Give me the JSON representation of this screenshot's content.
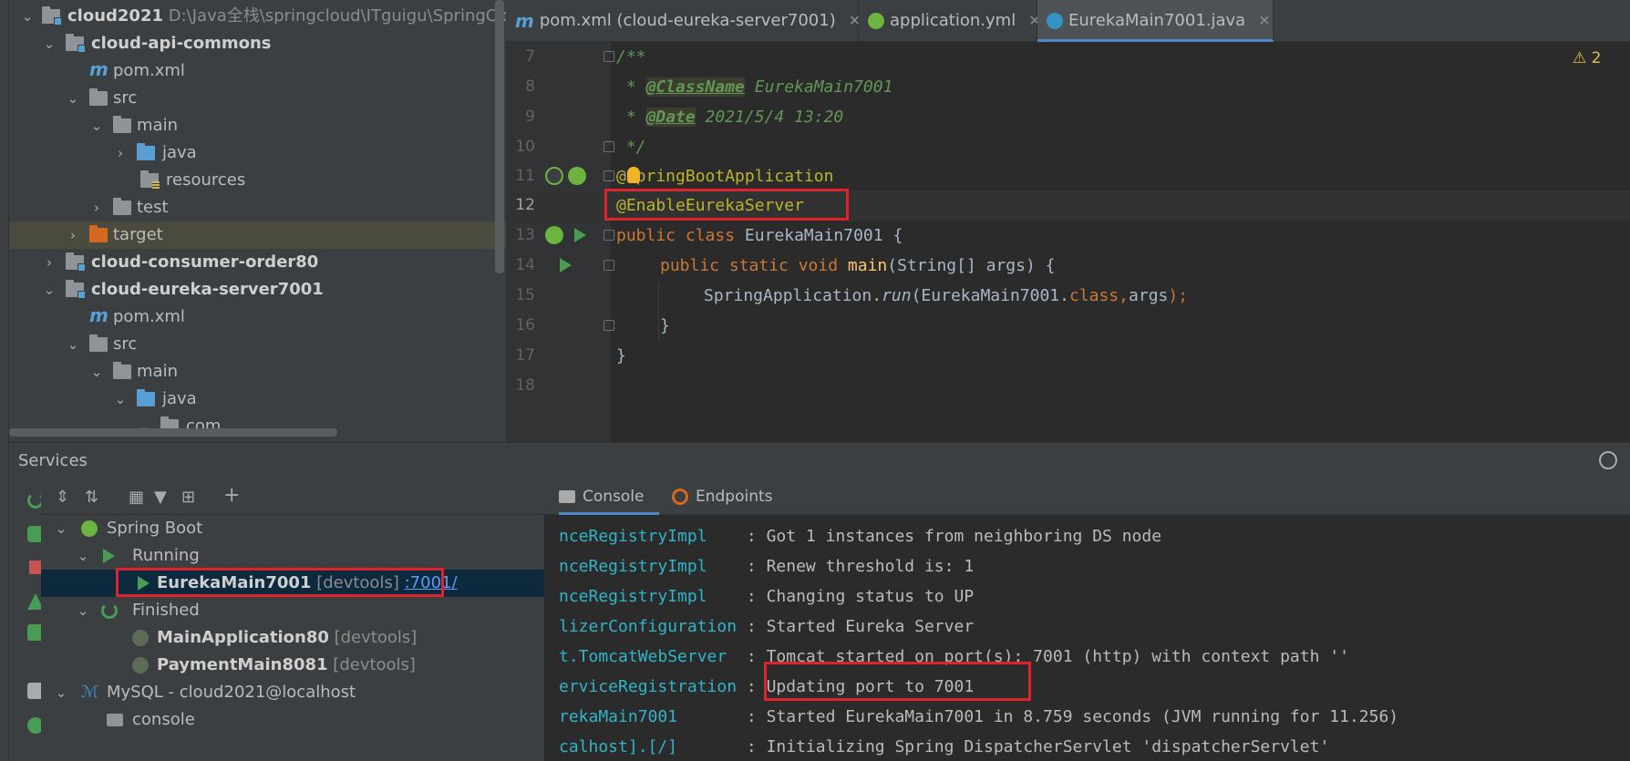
{
  "project_tree": {
    "root": {
      "name": "cloud2021",
      "path": "D:\\Java全栈\\springcloud\\ITguigu\\SpringClou"
    },
    "items": [
      {
        "label": "cloud-api-commons"
      },
      {
        "label": "pom.xml"
      },
      {
        "label": "src"
      },
      {
        "label": "main"
      },
      {
        "label": "java"
      },
      {
        "label": "resources"
      },
      {
        "label": "test"
      },
      {
        "label": "target"
      },
      {
        "label": "cloud-consumer-order80"
      },
      {
        "label": "cloud-eureka-server7001"
      },
      {
        "label": "pom.xml"
      },
      {
        "label": "src"
      },
      {
        "label": "main"
      },
      {
        "label": "java"
      },
      {
        "label": "com"
      }
    ]
  },
  "editor_tabs": [
    {
      "label": "pom.xml (cloud-eureka-server7001)",
      "icon": "maven-icon"
    },
    {
      "label": "application.yml",
      "icon": "spring-config-icon"
    },
    {
      "label": "EurekaMain7001.java",
      "icon": "java-class-icon"
    }
  ],
  "line_numbers": [
    "7",
    "8",
    "9",
    "10",
    "11",
    "12",
    "13",
    "14",
    "15",
    "16",
    "17",
    "18"
  ],
  "code": {
    "l7": "/**",
    "l8_tag": "@ClassName",
    "l8_val": " EurekaMain7001",
    "l9_tag": "@Date",
    "l9_val": " 2021/5/4 13:20",
    "l10": " */",
    "l11": "@SpringBootApplication",
    "l12": "@EnableEurekaServer",
    "l13_kw": "public class ",
    "l13_name": "EurekaMain7001 {",
    "l14_kw": "public static void ",
    "l14_fn": "main",
    "l14_rest": "(String[] args) {",
    "l15_a": "SpringApplication.",
    "l15_b": "run",
    "l15_c": "(EurekaMain7001.",
    "l15_d": "class",
    "l15_e": ",",
    "l15_f": "args",
    "l15_g": ");",
    "l16": "}",
    "l17": "}",
    "comment_star": " * "
  },
  "warning_badge": "⚠ 2",
  "services": {
    "title": "Services",
    "tree": {
      "spring_boot": "Spring Boot",
      "running": "Running",
      "running_app": {
        "name": "EurekaMain7001",
        "tag": "[devtools]",
        "port_link": ":7001/"
      },
      "finished": "Finished",
      "finished_apps": [
        {
          "name": "MainApplication80",
          "tag": "[devtools]"
        },
        {
          "name": "PaymentMain8081",
          "tag": "[devtools]"
        }
      ],
      "mysql": "MySQL - cloud2021@localhost",
      "console": "console"
    },
    "console_tabs": [
      "Console",
      "Endpoints"
    ],
    "log_lines": [
      {
        "logger": "nceRegistryImpl    ",
        "msg": ": Got 1 instances from neighboring DS node"
      },
      {
        "logger": "nceRegistryImpl    ",
        "msg": ": Renew threshold is: 1"
      },
      {
        "logger": "nceRegistryImpl    ",
        "msg": ": Changing status to UP"
      },
      {
        "logger": "lizerConfiguration ",
        "msg": ": Started Eureka Server"
      },
      {
        "logger": "t.TomcatWebServer  ",
        "msg": ": Tomcat started on port(s): 7001 (http) with context path ''"
      },
      {
        "logger": "erviceRegistration ",
        "msg": ": Updating port to 7001"
      },
      {
        "logger": "rekaMain7001       ",
        "msg": ": Started EurekaMain7001 in 8.759 seconds (JVM running for 11.256)"
      },
      {
        "logger": "calhost].[/]       ",
        "msg": ": Initializing Spring DispatcherServlet 'dispatcherServlet'"
      }
    ]
  },
  "colors": {
    "highlight_box": "#e0232b",
    "accent": "#4a88c7",
    "run_green": "#499c54"
  }
}
